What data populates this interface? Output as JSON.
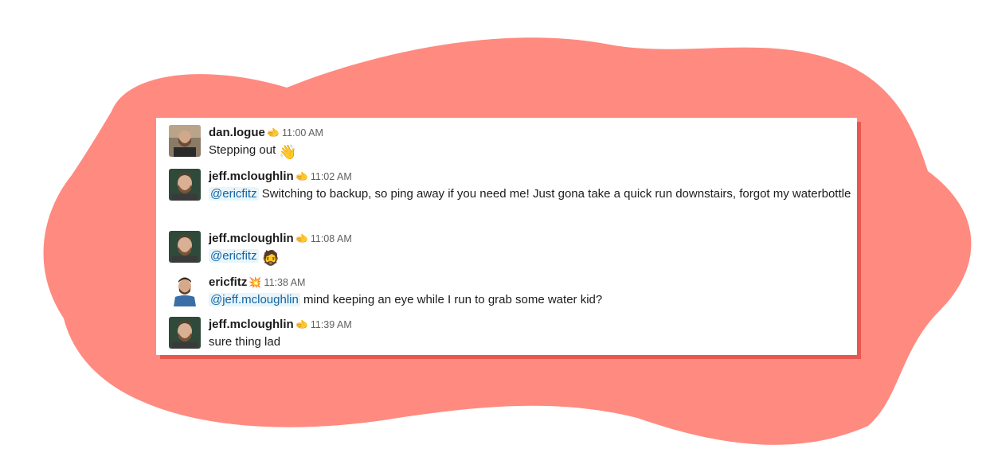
{
  "colors": {
    "blob": "#ff8a80",
    "shadow": "#e8574f",
    "mention": "#1264a3",
    "mention_bg": "#e8f5fa"
  },
  "messages": [
    {
      "user": "dan.logue",
      "status_icon": "pointing-hand-emoji",
      "status": "🫲",
      "time": "11:00 AM",
      "text": "Stepping out",
      "emoji": "👋"
    },
    {
      "user": "jeff.mcloughlin",
      "status_icon": "pointing-hand-emoji",
      "status": "🫲",
      "time": "11:02 AM",
      "mention": "@ericfitz",
      "text": " Switching to backup, so ping away if you need me! Just gona take a quick run downstairs, forgot my waterbottle"
    },
    {
      "user": "jeff.mcloughlin",
      "status_icon": "pointing-hand-emoji",
      "status": "🫲",
      "time": "11:08 AM",
      "mention": "@ericfitz",
      "emoji": "🧔"
    },
    {
      "user": "ericfitz",
      "status_icon": "collision-emoji",
      "status": "💥",
      "time": "11:38 AM",
      "mention": "@jeff.mcloughlin",
      "text": " mind keeping an eye while I run to grab some water kid?"
    },
    {
      "user": "jeff.mcloughlin",
      "status_icon": "pointing-hand-emoji",
      "status": "🫲",
      "time": "11:39 AM",
      "text": "sure thing lad"
    }
  ]
}
